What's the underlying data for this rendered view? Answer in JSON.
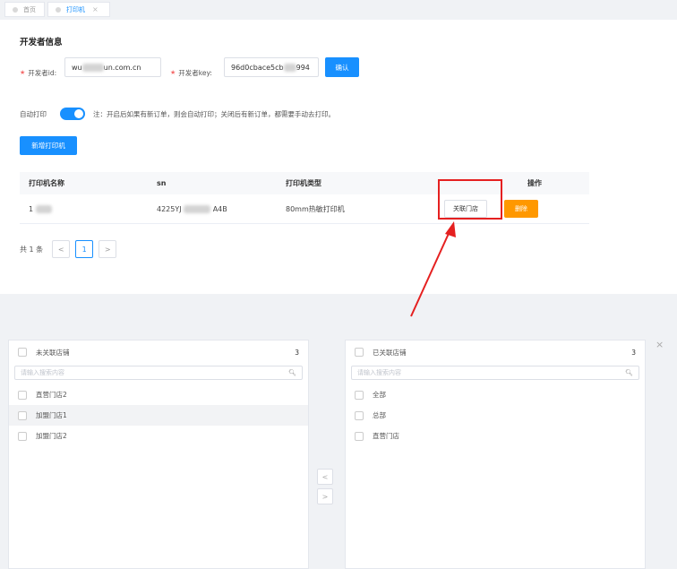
{
  "tabs": [
    {
      "label": "首页"
    },
    {
      "label": "打印机",
      "close": "×"
    }
  ],
  "developer": {
    "title": "开发者信息",
    "id_label": "开发者id:",
    "id_value_start": "wu",
    "id_value_end": "un.com.cn",
    "key_label": "开发者key:",
    "key_value_start": "96d0cbace5cb",
    "key_value_end": "994",
    "confirm_label": "确认"
  },
  "auto_print": {
    "label": "自动打印",
    "note": "注：开启后如果有新订单，则会自动打印；关闭后有新订单，都需要手动去打印。"
  },
  "add_printer_label": "新增打印机",
  "table": {
    "headers": [
      "打印机名称",
      "sn",
      "打印机类型",
      "操作"
    ],
    "rows": [
      {
        "name": "1",
        "sn_start": "4225YJ",
        "sn_end": "A4B",
        "type": "80mm热敏打印机",
        "link_label": "关联门店",
        "delete_label": "删除"
      }
    ]
  },
  "pagination": {
    "total_text": "共 1 条",
    "prev": "<",
    "page": "1",
    "next": ">"
  },
  "transfer": {
    "left": {
      "title": "未关联店铺",
      "count": "3",
      "placeholder": "请输入搜索内容",
      "items": [
        "直营门店2",
        "加盟门店1",
        "加盟门店2"
      ]
    },
    "right": {
      "title": "已关联店铺",
      "count": "3",
      "placeholder": "请输入搜索内容",
      "items": [
        "全部",
        "总部",
        "直营门店"
      ]
    },
    "to_left": "<",
    "to_right": ">",
    "close": "×"
  },
  "colors": {
    "primary": "#1890ff",
    "warning": "#ff9800",
    "annotation": "#e52020"
  }
}
